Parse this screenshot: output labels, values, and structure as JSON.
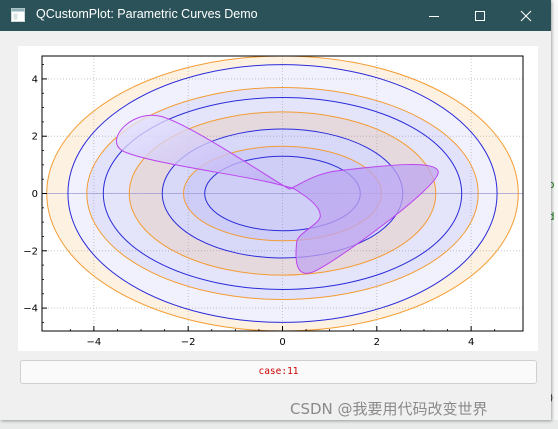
{
  "window": {
    "title": "QCustomPlot: Parametric Curves Demo",
    "controls": [
      "minimize",
      "maximize",
      "close"
    ]
  },
  "background": {
    "right_glyphs": [
      "o",
      "d"
    ],
    "corner_glyph": ")"
  },
  "status": {
    "text": "case:11"
  },
  "watermark": {
    "text": "CSDN @我要用代码改变世界"
  },
  "colors": {
    "titlebar": "#2b5258",
    "orange": "#f39c33",
    "blue": "#2b2bd9",
    "purple": "#bb44ee",
    "status_text": "#cc0000"
  },
  "chart_data": {
    "type": "line",
    "title": "",
    "xlabel": "",
    "ylabel": "",
    "xlim": [
      -5.1,
      5.1
    ],
    "ylim": [
      -4.8,
      4.8
    ],
    "xticks": [
      -4,
      -2,
      0,
      2,
      4
    ],
    "yticks": [
      -4,
      -2,
      0,
      2,
      4
    ],
    "grid": true,
    "series": [
      {
        "type": "ellipse",
        "center": [
          0,
          0
        ],
        "rx": 5.0,
        "ry": 4.8,
        "color": "orange"
      },
      {
        "type": "ellipse",
        "center": [
          0,
          0
        ],
        "rx": 4.55,
        "ry": 4.5,
        "color": "blue"
      },
      {
        "type": "ellipse",
        "center": [
          0,
          0
        ],
        "rx": 4.15,
        "ry": 3.7,
        "color": "orange"
      },
      {
        "type": "ellipse",
        "center": [
          0,
          0
        ],
        "rx": 3.8,
        "ry": 3.35,
        "color": "blue"
      },
      {
        "type": "ellipse",
        "center": [
          0,
          0
        ],
        "rx": 3.25,
        "ry": 2.85,
        "color": "orange"
      },
      {
        "type": "ellipse",
        "center": [
          0,
          0
        ],
        "rx": 2.55,
        "ry": 2.25,
        "color": "blue"
      },
      {
        "type": "ellipse",
        "center": [
          0,
          0
        ],
        "rx": 2.1,
        "ry": 1.65,
        "color": "orange"
      },
      {
        "type": "ellipse",
        "center": [
          0,
          0
        ],
        "rx": 1.65,
        "ry": 1.3,
        "color": "blue"
      },
      {
        "type": "trefoil",
        "x": [
          0.2,
          1.2,
          3.3,
          0.7,
          0.3,
          0.8,
          0.4,
          -0.3,
          -3.4,
          -2.6,
          0.15
        ],
        "y": [
          0.2,
          0.8,
          0.7,
          -2.7,
          -1.7,
          -0.8,
          0.0,
          0.4,
          1.5,
          2.7,
          0.15
        ],
        "color": "purple"
      }
    ]
  }
}
